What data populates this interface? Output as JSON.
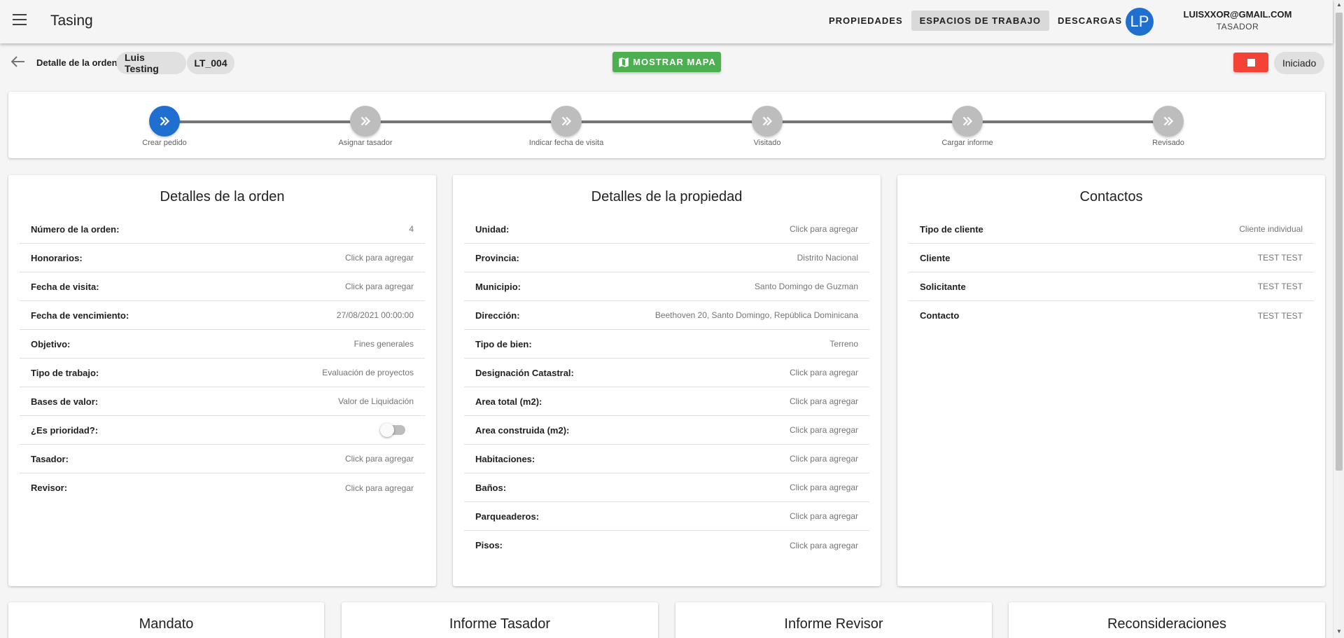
{
  "appbar": {
    "title": "Tasing",
    "nav": [
      "PROPIEDADES",
      "ESPACIOS DE TRABAJO",
      "DESCARGAS"
    ],
    "active_nav": "ESPACIOS DE TRABAJO",
    "avatar_initials": "LP",
    "user_email": "LUISXXOR@GMAIL.COM",
    "user_role": "TASADOR"
  },
  "subheader": {
    "title": "Detalle de la orden",
    "chip_client": "Luis Testing",
    "chip_code": "LT_004",
    "map_button": "MOSTRAR MAPA",
    "status": "Iniciado"
  },
  "stepper": {
    "steps": [
      "Crear pedido",
      "Asignar tasador",
      "Indicar fecha de visita",
      "Visitado",
      "Cargar informe",
      "Revisado"
    ],
    "active_index": 0,
    "active_color": "#1e6fd0",
    "inactive_color": "#bdbdbd"
  },
  "order": {
    "title": "Detalles de la orden",
    "rows": [
      {
        "label": "Número de la orden:",
        "value": "4"
      },
      {
        "label": "Honorarios:",
        "value": "Click para agregar"
      },
      {
        "label": "Fecha de visita:",
        "value": "Click para agregar"
      },
      {
        "label": "Fecha de vencimiento:",
        "value": "27/08/2021 00:00:00"
      },
      {
        "label": "Objetivo:",
        "value": "Fines generales"
      },
      {
        "label": "Tipo de trabajo:",
        "value": "Evaluación de proyectos"
      },
      {
        "label": "Bases de valor:",
        "value": "Valor de Liquidación"
      },
      {
        "label": "¿Es prioridad?:",
        "value": "",
        "toggle": false
      },
      {
        "label": "Tasador:",
        "value": "Click para agregar"
      },
      {
        "label": "Revisor:",
        "value": "Click para agregar"
      }
    ]
  },
  "property": {
    "title": "Detalles de la propiedad",
    "rows": [
      {
        "label": "Unidad:",
        "value": "Click para agregar"
      },
      {
        "label": "Provincia:",
        "value": "Distrito Nacional"
      },
      {
        "label": "Municipio:",
        "value": "Santo Domingo de Guzman"
      },
      {
        "label": "Dirección:",
        "value": "Beethoven 20, Santo Domingo, República Dominicana"
      },
      {
        "label": "Tipo de bien:",
        "value": "Terreno"
      },
      {
        "label": "Designación Catastral:",
        "value": "Click para agregar"
      },
      {
        "label": "Area total (m2):",
        "value": "Click para agregar"
      },
      {
        "label": "Area construida (m2):",
        "value": "Click para agregar"
      },
      {
        "label": "Habitaciones:",
        "value": "Click para agregar"
      },
      {
        "label": "Baños:",
        "value": "Click para agregar"
      },
      {
        "label": "Parqueaderos:",
        "value": "Click para agregar"
      },
      {
        "label": "Pisos:",
        "value": "Click para agregar"
      }
    ]
  },
  "contacts": {
    "title": "Contactos",
    "rows": [
      {
        "label": "Tipo de cliente",
        "value": "Cliente individual"
      },
      {
        "label": "Cliente",
        "value": "TEST TEST"
      },
      {
        "label": "Solicitante",
        "value": "TEST TEST"
      },
      {
        "label": "Contacto",
        "value": "TEST TEST"
      }
    ]
  },
  "bottom_cards": [
    "Mandato",
    "Informe Tasador",
    "Informe Revisor",
    "Reconsideraciones"
  ]
}
